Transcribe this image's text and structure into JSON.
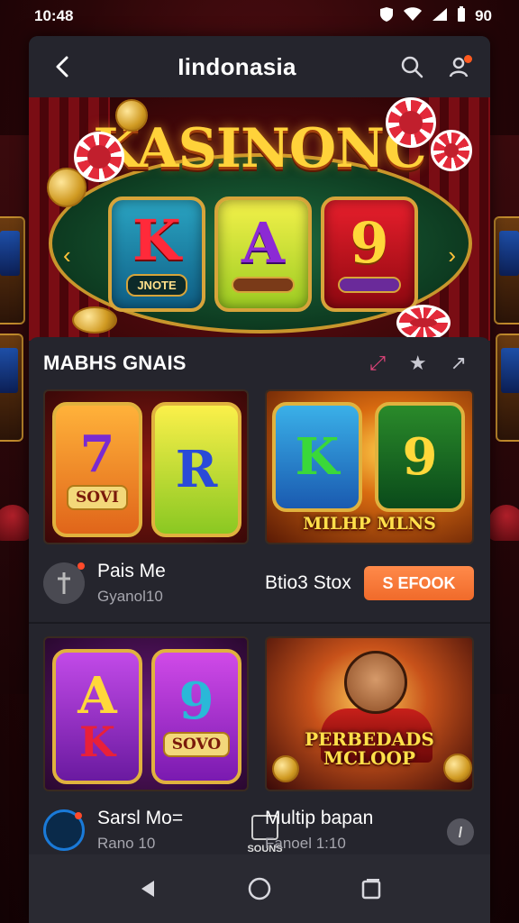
{
  "status_bar": {
    "time": "10:48",
    "battery": "90"
  },
  "header": {
    "title": "Iindonasia",
    "back_icon": "back-arrow-icon",
    "search_icon": "search-icon",
    "profile_icon": "user-settings-icon"
  },
  "banner": {
    "title": "KASINONC",
    "reels": [
      {
        "symbol": "K",
        "tag": "JNOTE"
      },
      {
        "symbol": "A",
        "tag": ""
      },
      {
        "symbol": "9",
        "tag": ""
      }
    ]
  },
  "section": {
    "title": "MABHS GNAIS",
    "actions": [
      "sort-icon",
      "star-icon",
      "arrow-icon"
    ]
  },
  "games": [
    {
      "thumb_symbols": [
        "7",
        "R"
      ],
      "thumb_label": "SOVI",
      "name": "Pais Me",
      "subtitle": "Gyanol10"
    },
    {
      "thumb_symbols": [
        "K",
        "9"
      ],
      "thumb_caption": "MILHP MLNS",
      "name": "Btio3 Stox",
      "cta_label": "S EFOOK"
    },
    {
      "thumb_symbols": [
        "A",
        "9"
      ],
      "thumb_symbols_extra": [
        "K"
      ],
      "thumb_label": "SOVO",
      "name": "Sarsl Mo=",
      "subtitle": "Rano 10",
      "badge_label": "SOUNS"
    },
    {
      "thumb_caption": "PERBEDADS\nMCLOOP",
      "name": "Multip bapan",
      "subtitle": "Fanoel 1:10"
    }
  ],
  "colors": {
    "accent": "#f06a2a",
    "panel": "#23232b",
    "gold": "#ffd23a",
    "badge": "#ff5a1f"
  }
}
